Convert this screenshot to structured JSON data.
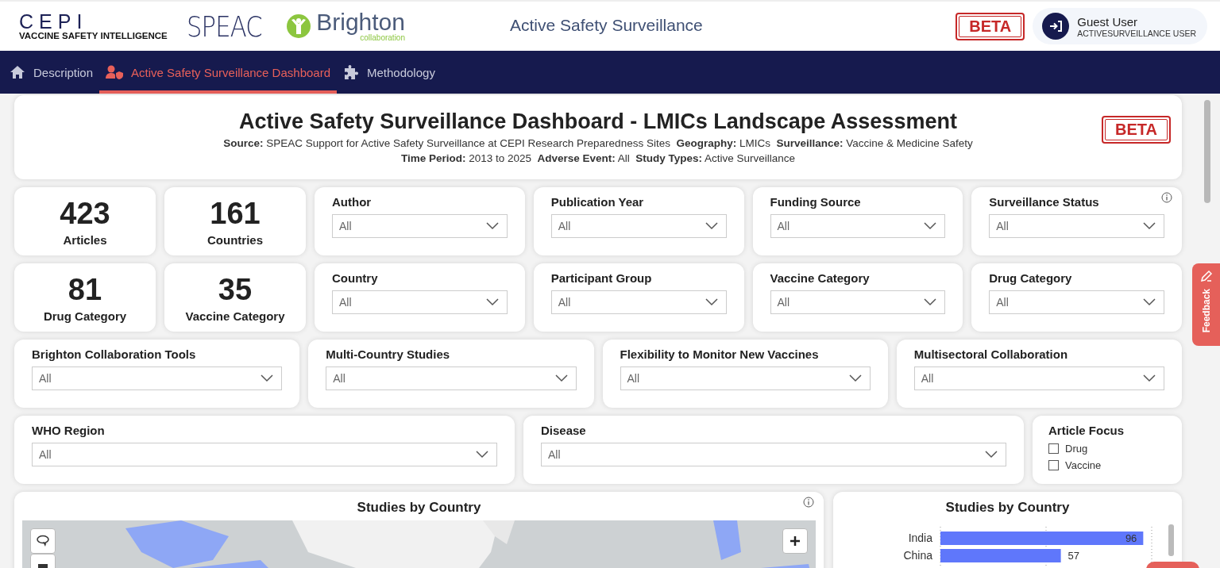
{
  "header": {
    "cepi": "CEPI",
    "cepi_tagline": "VACCINE SAFETY INTELLIGENCE",
    "speac": "SPEAC",
    "brighton": "Brighton",
    "brighton_sub": "collaboration",
    "title": "Active Safety Surveillance",
    "badge": "BETA",
    "user": {
      "name": "Guest User",
      "role": "ACTIVESURVEILLANCE USER"
    }
  },
  "nav": [
    {
      "label": "Description",
      "kind": "home",
      "selected": false
    },
    {
      "label": "Active Safety Surveillance Dashboard",
      "kind": "user-shield",
      "selected": true
    },
    {
      "label": "Methodology",
      "kind": "puzzle",
      "selected": false
    }
  ],
  "title_card": {
    "title": "Active Safety Surveillance Dashboard - LMICs Landscape Assessment",
    "badge": "BETA",
    "meta": [
      "**Source:** SPEAC Support for Active Safety Surveillance at CEPI Research Preparedness Sites  **Geography:** LMICs  **Surveillance:** Vaccine & Medicine Safety",
      "**Time Period:** 2013 to 2025  **Adverse Event:** All  **Study Types:** Active Surveillance"
    ]
  },
  "rows": [
    [
      {
        "kind": "kpi",
        "value": "423",
        "label": "Articles"
      },
      {
        "kind": "kpi",
        "value": "161",
        "label": "Countries"
      },
      {
        "kind": "slicer",
        "label": "Author",
        "value": "All",
        "info": false
      },
      {
        "kind": "slicer",
        "label": "Publication Year",
        "value": "All",
        "info": false
      },
      {
        "kind": "slicer",
        "label": "Funding Source",
        "value": "All",
        "info": false
      },
      {
        "kind": "slicer",
        "label": "Surveillance Status",
        "value": "All",
        "info": true
      }
    ],
    [
      {
        "kind": "kpi",
        "value": "81",
        "label": "Drug Category"
      },
      {
        "kind": "kpi",
        "value": "35",
        "label": "Vaccine Category"
      },
      {
        "kind": "slicer",
        "label": "Country",
        "value": "All",
        "info": false
      },
      {
        "kind": "slicer",
        "label": "Participant Group",
        "value": "All",
        "info": false
      },
      {
        "kind": "slicer",
        "label": "Vaccine Category",
        "value": "All",
        "info": false
      },
      {
        "kind": "slicer",
        "label": "Drug Category",
        "value": "All",
        "info": false
      }
    ],
    [
      {
        "kind": "slicer",
        "label": "Brighton Collaboration Tools",
        "value": "All",
        "info": false
      },
      {
        "kind": "slicer",
        "label": "Multi-Country Studies",
        "value": "All",
        "info": false
      },
      {
        "kind": "slicer",
        "label": "Flexibility to Monitor New Vaccines",
        "value": "All",
        "info": false
      },
      {
        "kind": "slicer",
        "label": "Multisectoral Collaboration",
        "value": "All",
        "info": false
      }
    ],
    [
      {
        "kind": "slicer",
        "label": "WHO Region",
        "value": "All",
        "info": false
      },
      {
        "kind": "slicer",
        "label": "Disease",
        "value": "All",
        "info": false
      },
      {
        "kind": "checklist",
        "label": "Article Focus",
        "options": [
          {
            "label": "Drug",
            "checked": false
          },
          {
            "label": "Vaccine",
            "checked": false
          }
        ]
      }
    ]
  ],
  "map_card": {
    "title": "Studies by Country",
    "info": true,
    "kind": "picture"
  },
  "bar_card": {
    "chart_data": {
      "type": "bar",
      "orientation": "horizontal",
      "title": "Studies by Country",
      "categories": [
        "India",
        "China"
      ],
      "values": [
        96,
        57
      ],
      "data_labels": true
    }
  },
  "feedback": "Feedback"
}
